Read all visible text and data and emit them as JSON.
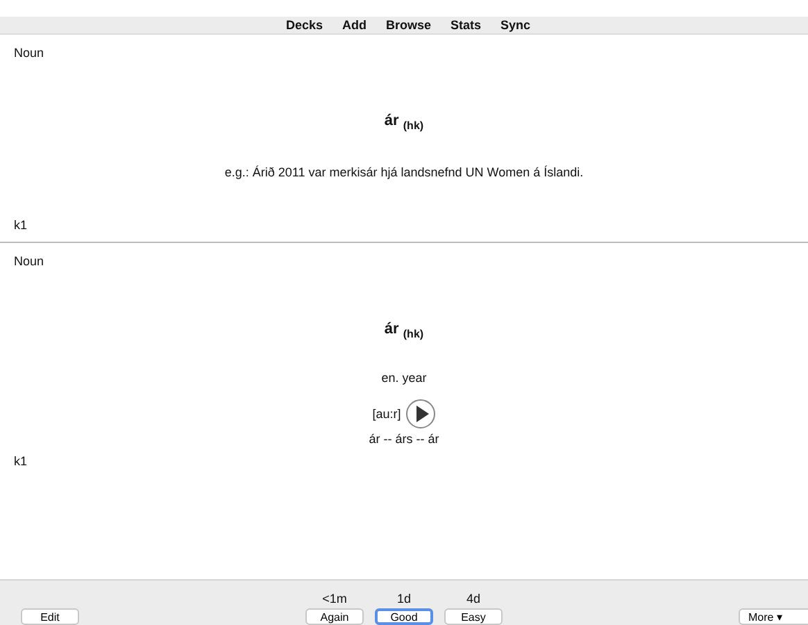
{
  "menu": [
    {
      "label": "Decks"
    },
    {
      "label": "Add"
    },
    {
      "label": "Browse"
    },
    {
      "label": "Stats"
    },
    {
      "label": "Sync"
    }
  ],
  "question": {
    "part_of_speech": "Noun",
    "word": "ár",
    "gender": "(hk)",
    "example": "e.g.: Árið 2011 var merkisár hjá landsnefnd UN Women á Íslandi.",
    "tag": "k1"
  },
  "answer": {
    "part_of_speech": "Noun",
    "word": "ár",
    "gender": "(hk)",
    "translation": "en. year",
    "pronunciation": "[au:r]",
    "forms": "ár -- árs -- ár",
    "tag": "k1"
  },
  "bottom_bar": {
    "edit_button": "Edit",
    "answers": [
      {
        "interval": "<1m",
        "label": "Again",
        "selected": false
      },
      {
        "interval": "1d",
        "label": "Good",
        "selected": true
      },
      {
        "interval": "4d",
        "label": "Easy",
        "selected": false
      }
    ],
    "more_button": "More ▾"
  }
}
